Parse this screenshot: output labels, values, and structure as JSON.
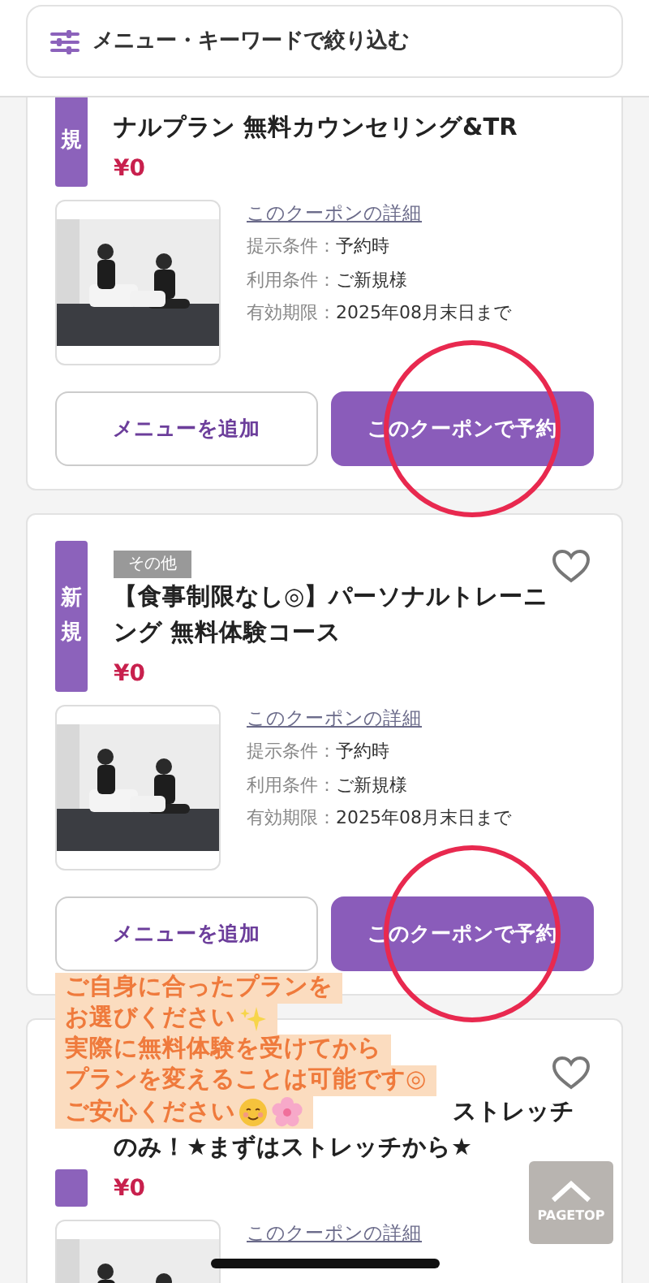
{
  "filter_bar": {
    "label": "メニュー・キーワードで絞り込む"
  },
  "coupons": [
    {
      "badge": "規",
      "title_lines": [
        "ナルプラン 無料カウンセリング&TR"
      ],
      "price": "¥0",
      "photo": {
        "kind": "picture"
      },
      "detail_link": "このクーポンの詳細",
      "conditions": [
        {
          "label": "提示条件：",
          "value": "予約時"
        },
        {
          "label": "利用条件：",
          "value": "ご新規様"
        },
        {
          "label": "有効期限：",
          "value": "2025年08月末日まで"
        }
      ],
      "buttons": {
        "add": "メニューを追加",
        "reserve": "このクーポンで予約"
      },
      "circled": true
    },
    {
      "badge": "新規",
      "tag": "その他",
      "favorite": false,
      "title_lines": [
        "【食事制限なし◎】パーソナルトレーニ",
        "ング 無料体験コース"
      ],
      "price": "¥0",
      "photo": {
        "kind": "picture"
      },
      "detail_link": "このクーポンの詳細",
      "conditions": [
        {
          "label": "提示条件：",
          "value": "予約時"
        },
        {
          "label": "利用条件：",
          "value": "ご新規様"
        },
        {
          "label": "有効期限：",
          "value": "2025年08月末日まで"
        }
      ],
      "buttons": {
        "add": "メニューを追加",
        "reserve": "このクーポンで予約"
      },
      "circled": true
    },
    {
      "favorite": false,
      "title_covered": true,
      "title_lines": [
        "ストレッチ",
        "のみ！★まずはストレッチから★"
      ],
      "price": "¥0",
      "photo": {
        "kind": "picture"
      },
      "detail_link": "このクーポンの詳細"
    }
  ],
  "note": {
    "lines": [
      {
        "text": "ご自身に合ったプランを"
      },
      {
        "text": "お選びください"
      },
      {
        "text": "実際に無料体験を受けてから"
      },
      {
        "text": "プランを変えることは可能です◎"
      },
      {
        "text": "ご安心ください"
      }
    ]
  },
  "pagetop": {
    "label": "PAGETOP"
  }
}
